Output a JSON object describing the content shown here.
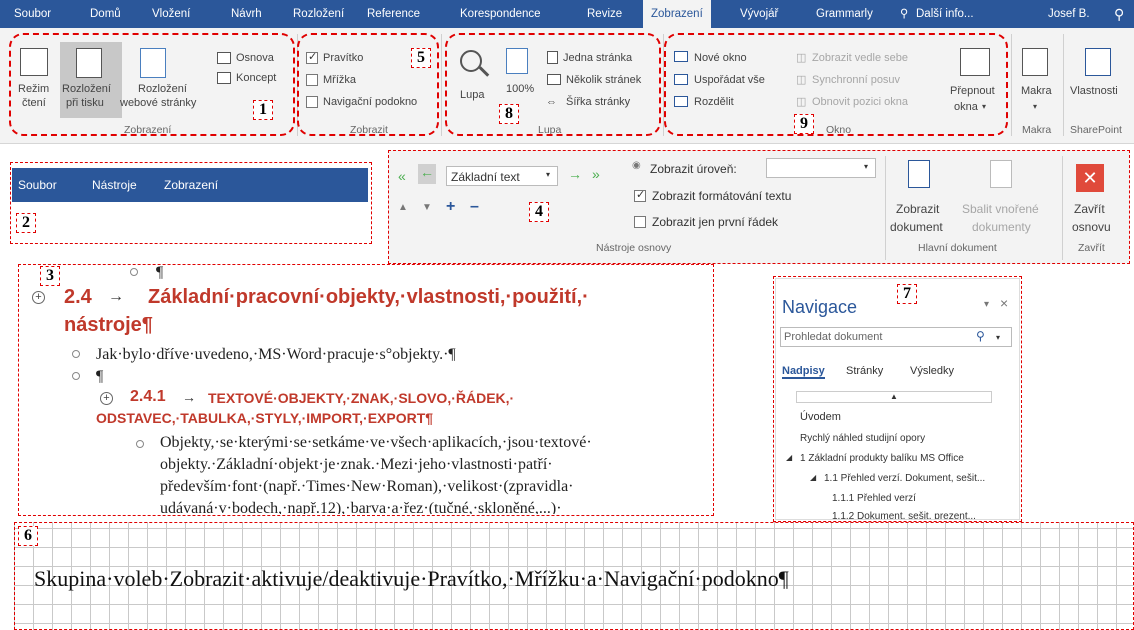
{
  "tabs": [
    "Soubor",
    "Domů",
    "Vložení",
    "Návrh",
    "Rozložení",
    "Reference",
    "Korespondence",
    "Revize",
    "Zobrazení",
    "Vývojář",
    "Grammarly",
    "Další info...",
    "Josef B."
  ],
  "views": {
    "read_l1": "Režim",
    "read_l2": "čtení",
    "print_l1": "Rozložení",
    "print_l2": "při tisku",
    "web_l1": "Rozložení",
    "web_l2": "webové stránky",
    "outline": "Osnova",
    "draft": "Koncept",
    "group": "Zobrazení"
  },
  "show": {
    "ruler": "Pravítko",
    "grid": "Mřížka",
    "navpane": "Navigační podokno",
    "group": "Zobrazit"
  },
  "zoom": {
    "lupa": "Lupa",
    "p100": "100%",
    "one": "Jedna stránka",
    "multi": "Několik stránek",
    "width": "Šířka stránky",
    "group": "Lupa"
  },
  "window": {
    "new": "Nové okno",
    "arrange": "Uspořádat vše",
    "split": "Rozdělit",
    "side": "Zobrazit vedle sebe",
    "sync": "Synchronní posuv",
    "reset": "Obnovit pozici okna",
    "switch_l1": "Přepnout",
    "switch_l2": "okna",
    "group": "Okno"
  },
  "macros": {
    "label": "Makra",
    "group": "Makra"
  },
  "sharepoint": {
    "label": "Vlastnosti",
    "group": "SharePoint"
  },
  "vba": {
    "m1": "Soubor",
    "m2": "Nástroje",
    "m3": "Zobrazení"
  },
  "outline_tools": {
    "level": "Základní text",
    "show_level": "Zobrazit úroveň:",
    "show_fmt": "Zobrazit formátování textu",
    "first_line": "Zobrazit jen první řádek",
    "group": "Nástroje osnovy",
    "show_doc_l1": "Zobrazit",
    "show_doc_l2": "dokument",
    "collapse_l1": "Sbalit vnořené",
    "collapse_l2": "dokumenty",
    "master_group": "Hlavní dokument",
    "close_l1": "Zavřít",
    "close_l2": "osnovu",
    "close_group": "Zavřít"
  },
  "doc": {
    "pilcrow": "¶",
    "h_num": "2.4",
    "h_title1": "Základní·pracovní·objekty,·vlastnosti,·použití,·",
    "h_title2": "nástroje¶",
    "p1": "Jak·bylo·dříve·uvedeno,·MS·Word·pracuje·s°objekty.·¶",
    "h3_num": "2.4.1",
    "h3_l1": "TEXTOVÉ·OBJEKTY,·ZNAK,·SLOVO,·ŘÁDEK,·",
    "h3_l2": "ODSTAVEC,·TABULKA,·STYLY,·IMPORT,·EXPORT¶",
    "b1": "Objekty,·se·kterými·se·setkáme·ve·všech·aplikacích,·jsou·textové·",
    "b2": "objekty.·Základní·objekt·je·znak.·Mezi·jeho·vlastnosti·patří·",
    "b3": "především·font·(např.·Times·New·Roman),·velikost·(zpravidla·",
    "b4": "udávaná·v·bodech,·např.12),·barva·a·řez·(tučné,·skloněné,...)·"
  },
  "navpane": {
    "title": "Navigace",
    "search": "Prohledat dokument",
    "tab1": "Nadpisy",
    "tab2": "Stránky",
    "tab3": "Výsledky",
    "i1": "Úvodem",
    "i2": "Rychlý náhled studijní opory",
    "i3": "1 Základní produkty balíku MS Office",
    "i4": "1.1 Přehled verzí. Dokument, sešit...",
    "i5": "1.1.1 Přehled verzí",
    "i6": "1.1.2 Dokument, sešit, prezent..."
  },
  "grid_text": "Skupina·voleb·Zobrazit·aktivuje/deaktivuje·Pravítko,·Mřížku·a·Navigační·podokno¶",
  "markers": [
    "1",
    "2",
    "3",
    "4",
    "5",
    "6",
    "7",
    "8",
    "9"
  ],
  "colors": {
    "accent": "#2b579a",
    "heading": "#c0392b",
    "annotation": "#e00000",
    "close_btn": "#e04a3b"
  }
}
